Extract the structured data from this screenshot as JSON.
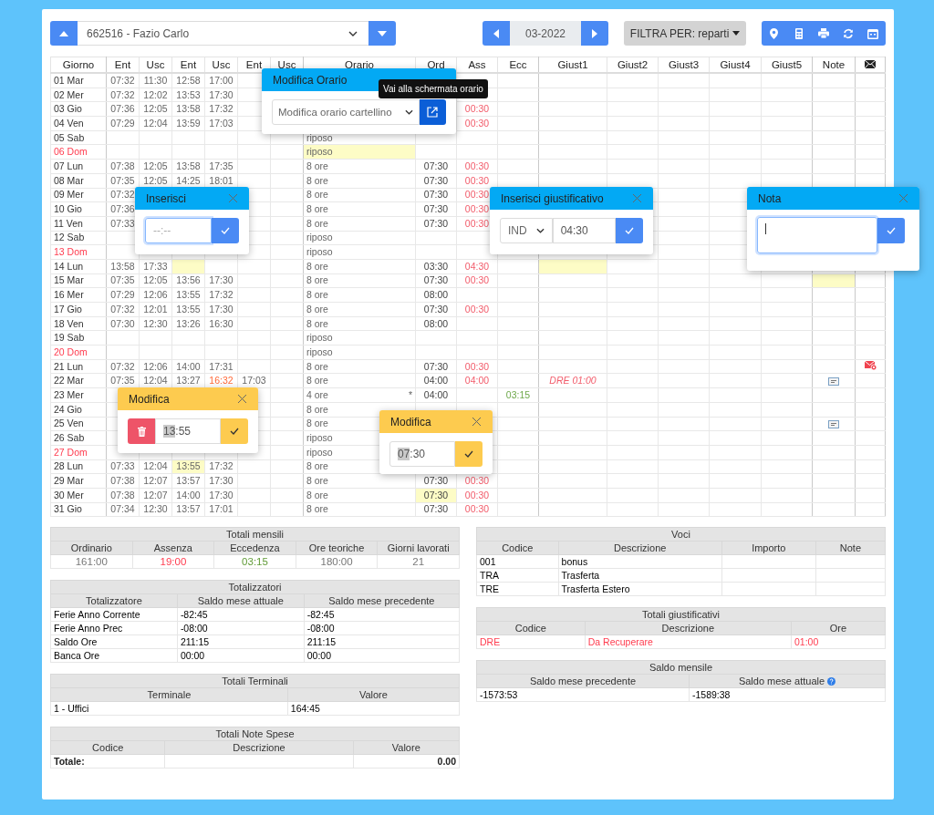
{
  "toolbar": {
    "employee": "662516 - Fazio Carlo",
    "month": "03-2022",
    "filter": "FILTRA PER: reparti"
  },
  "columns": [
    "Giorno",
    "Ent",
    "Usc",
    "Ent",
    "Usc",
    "Ent",
    "Usc",
    "Orario",
    "Ord",
    "Ass",
    "Ecc",
    "Giust1",
    "Giust2",
    "Giust3",
    "Giust4",
    "Giust5",
    "Note"
  ],
  "rows": [
    {
      "giorno": "01 Mar",
      "holiday": false,
      "ent1": "07:32",
      "usc1": "11:30",
      "ent2": "12:58",
      "usc2": "17:00"
    },
    {
      "giorno": "02 Mer",
      "holiday": false,
      "ent1": "07:32",
      "usc1": "12:02",
      "ent2": "13:53",
      "usc2": "17:30"
    },
    {
      "giorno": "03 Gio",
      "holiday": false,
      "ent1": "07:36",
      "usc1": "12:05",
      "ent2": "13:58",
      "usc2": "17:32",
      "ass": "00:30"
    },
    {
      "giorno": "04 Ven",
      "holiday": false,
      "ent1": "07:29",
      "usc1": "12:04",
      "ent2": "13:59",
      "usc2": "17:03",
      "ass": "00:30"
    },
    {
      "giorno": "05 Sab",
      "holiday": false,
      "orario": "riposo"
    },
    {
      "giorno": "06 Dom",
      "holiday": true,
      "orario": "riposo",
      "highlight": {
        "orario": true
      }
    },
    {
      "giorno": "07 Lun",
      "holiday": false,
      "ent1": "07:38",
      "usc1": "12:05",
      "ent2": "13:58",
      "usc2": "17:35",
      "orario": "8 ore",
      "ord": "07:30",
      "ass": "00:30"
    },
    {
      "giorno": "08 Mar",
      "holiday": false,
      "ent1": "07:35",
      "usc1": "12:05",
      "ent2": "14:25",
      "usc2": "18:01",
      "orario": "8 ore",
      "ord": "07:30",
      "ass": "00:30"
    },
    {
      "giorno": "09 Mer",
      "holiday": false,
      "ent1": "07:32",
      "orario": "8 ore",
      "ord": "07:30",
      "ass": "00:30"
    },
    {
      "giorno": "10 Gio",
      "holiday": false,
      "ent1": "07:36",
      "orario": "8 ore",
      "ord": "07:30",
      "ass": "00:30"
    },
    {
      "giorno": "11 Ven",
      "holiday": false,
      "ent1": "07:33",
      "orario": "8 ore",
      "ord": "07:30",
      "ass": "00:30"
    },
    {
      "giorno": "12 Sab",
      "holiday": false,
      "orario": "riposo"
    },
    {
      "giorno": "13 Dom",
      "holiday": true,
      "orario": "riposo"
    },
    {
      "giorno": "14 Lun",
      "holiday": false,
      "ent1": "13:58",
      "usc1": "17:33",
      "orario": "8 ore",
      "ord": "03:30",
      "ass": "04:30",
      "highlight": {
        "ent2": true,
        "giust1": true
      }
    },
    {
      "giorno": "15 Mar",
      "holiday": false,
      "ent1": "07:35",
      "usc1": "12:05",
      "ent2": "13:56",
      "usc2": "17:30",
      "orario": "8 ore",
      "ord": "07:30",
      "ass": "00:30",
      "highlight": {
        "note": true
      }
    },
    {
      "giorno": "16 Mer",
      "holiday": false,
      "ent1": "07:29",
      "usc1": "12:06",
      "ent2": "13:55",
      "usc2": "17:32",
      "orario": "8 ore",
      "ord": "08:00"
    },
    {
      "giorno": "17 Gio",
      "holiday": false,
      "ent1": "07:32",
      "usc1": "12:01",
      "ent2": "13:55",
      "usc2": "17:30",
      "orario": "8 ore",
      "ord": "07:30",
      "ass": "00:30"
    },
    {
      "giorno": "18 Ven",
      "holiday": false,
      "ent1": "07:30",
      "usc1": "12:30",
      "ent2": "13:26",
      "usc2": "16:30",
      "orario": "8 ore",
      "ord": "08:00"
    },
    {
      "giorno": "19 Sab",
      "holiday": false,
      "orario": "riposo"
    },
    {
      "giorno": "20 Dom",
      "holiday": true,
      "orario": "riposo"
    },
    {
      "giorno": "21 Lun",
      "holiday": false,
      "ent1": "07:32",
      "usc1": "12:06",
      "ent2": "14:00",
      "usc2": "17:31",
      "orario": "8 ore",
      "ord": "07:30",
      "ass": "00:30",
      "mail": true
    },
    {
      "giorno": "22 Mar",
      "holiday": false,
      "ent1": "07:35",
      "usc1": "12:04",
      "ent2": "13:27",
      "usc2": "16:32",
      "ent3": "17:03",
      "orario": "8 ore",
      "ord": "04:00",
      "ass": "04:00",
      "giust1": "DRE 01:00",
      "note": true,
      "late": {
        "usc2": true
      }
    },
    {
      "giorno": "23 Mer",
      "holiday": false,
      "orario": "4 ore",
      "orario_flag": "*",
      "ord": "04:00",
      "ecc": "03:15"
    },
    {
      "giorno": "24 Gio",
      "holiday": false,
      "orario": "8 ore"
    },
    {
      "giorno": "25 Ven",
      "holiday": false,
      "orario": "8 ore",
      "note": true
    },
    {
      "giorno": "26 Sab",
      "holiday": false,
      "orario": "riposo"
    },
    {
      "giorno": "27 Dom",
      "holiday": true,
      "orario": "riposo"
    },
    {
      "giorno": "28 Lun",
      "holiday": false,
      "ent1": "07:33",
      "usc1": "12:04",
      "ent2": "13:55",
      "usc2": "17:32",
      "orario": "8 ore",
      "highlight": {
        "ent2": true
      }
    },
    {
      "giorno": "29 Mar",
      "holiday": false,
      "ent1": "07:38",
      "usc1": "12:07",
      "ent2": "13:57",
      "usc2": "17:30",
      "orario": "8 ore",
      "ord": "07:30",
      "ass": "00:30"
    },
    {
      "giorno": "30 Mer",
      "holiday": false,
      "ent1": "07:38",
      "usc1": "12:07",
      "ent2": "14:00",
      "usc2": "17:30",
      "orario": "8 ore",
      "ord": "07:30",
      "ass": "00:30",
      "highlight": {
        "ord": true
      }
    },
    {
      "giorno": "31 Gio",
      "holiday": false,
      "ent1": "07:34",
      "usc1": "12:30",
      "ent2": "13:57",
      "usc2": "17:01",
      "orario": "8 ore",
      "ord": "07:30",
      "ass": "00:30"
    }
  ],
  "popovers": [
    {
      "kind": "orario",
      "title": "Modifica Orario",
      "color": "#03a9f4",
      "select": "Modifica orario cartellino",
      "tooltip": "Vai alla schermata orario"
    },
    {
      "kind": "time",
      "title": "Inserisci",
      "color": "#03a9f4",
      "placeholder": "--:--",
      "focused": true
    },
    {
      "kind": "giustificativo",
      "title": "Inserisci giustificativo",
      "color": "#03a9f4",
      "select": "IND",
      "value": "04:30"
    },
    {
      "kind": "nota",
      "title": "Nota",
      "color": "#03a9f4",
      "focused": true
    },
    {
      "kind": "time",
      "title": "Modifica",
      "color": "#fdcb4f",
      "value": "13:55",
      "delete": true,
      "text_selected": true
    },
    {
      "kind": "time",
      "title": "Modifica",
      "color": "#fdcb4f",
      "value": "07:30",
      "text_selected": true
    }
  ],
  "totali_mensili": {
    "title": "Totali mensili",
    "items": [
      {
        "label": "Ordinario",
        "value": "161:00"
      },
      {
        "label": "Assenza",
        "value": "19:00",
        "color": "#ff3b4e"
      },
      {
        "label": "Eccedenza",
        "value": "03:15",
        "color": "#5f9a35"
      },
      {
        "label": "Ore teoriche",
        "value": "180:00"
      },
      {
        "label": "Giorni lavorati",
        "value": "21"
      }
    ]
  },
  "totalizzatori": {
    "title": "Totalizzatori",
    "columns": [
      "Totalizzatore",
      "Saldo mese attuale",
      "Saldo mese precedente"
    ],
    "rows": [
      [
        "Ferie Anno Corrente",
        "-82:45",
        "-82:45"
      ],
      [
        "Ferie Anno Prec",
        "-08:00",
        "-08:00"
      ],
      [
        "Saldo Ore",
        "211:15",
        "211:15"
      ],
      [
        "Banca Ore",
        "00:00",
        "00:00"
      ]
    ]
  },
  "totali_terminali": {
    "title": "Totali Terminali",
    "columns": [
      "Terminale",
      "Valore"
    ],
    "rows": [
      [
        "1 - Uffici",
        "164:45"
      ]
    ]
  },
  "totali_note_spese": {
    "title": "Totali Note Spese",
    "columns": [
      "Codice",
      "Descrizione",
      "Valore"
    ],
    "total": {
      "label": "Totale:",
      "value": "0.00"
    }
  },
  "voci": {
    "title": "Voci",
    "columns": [
      "Codice",
      "Descrizione",
      "Importo",
      "Note"
    ],
    "rows": [
      [
        "001",
        "bonus"
      ],
      [
        "TRA",
        "Trasferta"
      ],
      [
        "TRE",
        "Trasferta Estero"
      ]
    ]
  },
  "totali_giustificativi": {
    "title": "Totali giustificativi",
    "columns": [
      "Codice",
      "Descrizione",
      "Ore"
    ],
    "rows": [
      {
        "cells": [
          "DRE",
          "Da Recuperare",
          "01:00"
        ],
        "color": "#ff3b4e"
      }
    ]
  },
  "saldo_mensile": {
    "title": "Saldo mensile",
    "columns": [
      "Saldo mese precedente",
      "Saldo mese attuale"
    ],
    "rows": [
      [
        "-1573:53",
        "-1589:38"
      ]
    ]
  }
}
